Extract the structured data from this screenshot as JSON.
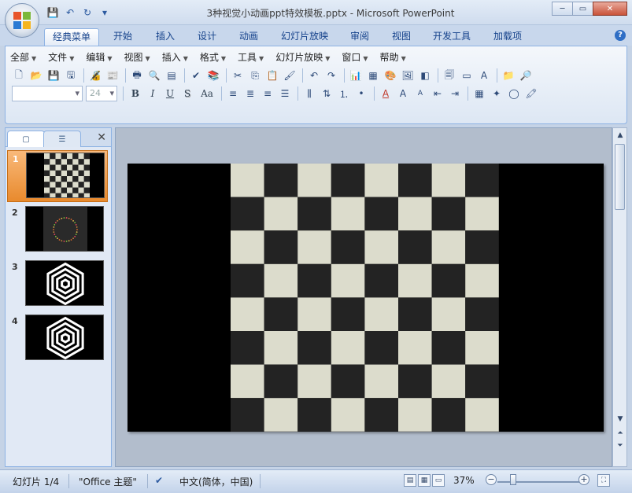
{
  "window": {
    "title": "3种视觉小动画ppt特效模板.pptx - Microsoft PowerPoint",
    "controls": {
      "minimize": "─",
      "maximize": "▭",
      "close": "✕"
    }
  },
  "quick_access": {
    "save": "💾",
    "undo": "↶",
    "redo": "↻",
    "customize": "▾"
  },
  "ribbon_tabs": [
    "经典菜单",
    "开始",
    "插入",
    "设计",
    "动画",
    "幻灯片放映",
    "审阅",
    "视图",
    "开发工具",
    "加载项"
  ],
  "active_tab": "经典菜单",
  "help": "?",
  "classic_menu": [
    "全部",
    "文件",
    "编辑",
    "视图",
    "插入",
    "格式",
    "工具",
    "幻灯片放映",
    "窗口",
    "帮助"
  ],
  "font": {
    "family": "",
    "size": "24"
  },
  "format_buttons": {
    "bold": "B",
    "italic": "I",
    "underline": "U",
    "shadow": "S",
    "case": "Aa"
  },
  "toolbar_glyph": {
    "font_color": "A",
    "grow_font": "A",
    "shrink_font": "A"
  },
  "panel": {
    "slides_tab": "▢",
    "outline_tab": "☰",
    "close": "✕"
  },
  "slides": [
    {
      "number": "1",
      "kind": "checkerboard"
    },
    {
      "number": "2",
      "kind": "dot-ring"
    },
    {
      "number": "3",
      "kind": "hexagon-rings"
    },
    {
      "number": "4",
      "kind": "hexagon-rings"
    }
  ],
  "selected_slide": 1,
  "colors": {
    "checker_light": "#dcdccc",
    "checker_dark": "#232323",
    "selection": "#e88a2d"
  },
  "status": {
    "slide_indicator": "幻灯片 1/4",
    "theme": "\"Office 主题\"",
    "language": "中文(简体，中国)",
    "zoom": "37%",
    "zoom_fraction": 0.37
  }
}
